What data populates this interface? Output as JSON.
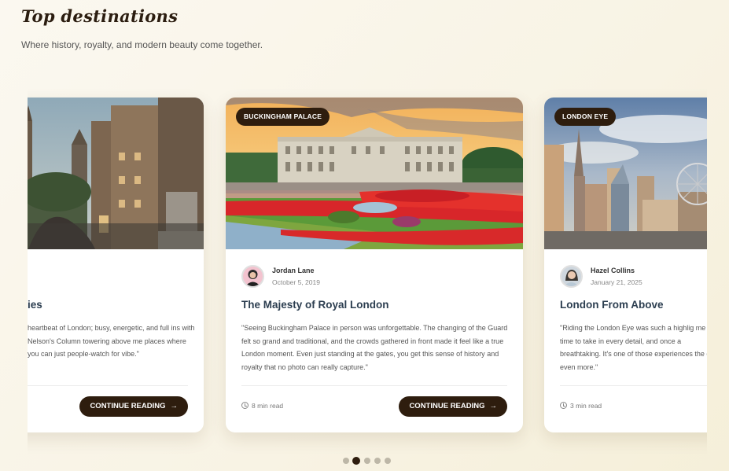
{
  "header": {
    "title": "Top destinations",
    "subtitle": "Where history, royalty, and modern beauty come together."
  },
  "cards": [
    {
      "tag": "",
      "author": "",
      "date": "",
      "title": "ies",
      "text": "heartbeat of London; busy, energetic, and full ins with Nelson's Column towering above me places where you can just people-watch for vibe.\"",
      "read_time": "",
      "button": "CONTINUE READING"
    },
    {
      "tag": "BUCKINGHAM PALACE",
      "author": "Jordan Lane",
      "date": "October 5, 2019",
      "title": "The Majesty of Royal London",
      "text": "\"Seeing Buckingham Palace in person was unforgettable. The changing of the Guard felt so grand and traditional, and the crowds gathered in front made it feel like a true London moment. Even just standing at the gates, you get this sense of history and royalty that no photo can really capture.\"",
      "read_time": "8 min read",
      "button": "CONTINUE READING"
    },
    {
      "tag": "LONDON EYE",
      "author": "Hazel Collins",
      "date": "January 21, 2025",
      "title": "London From Above",
      "text": "\"Riding the London Eye was such a highlig me time to take in every detail, and once a breathtaking. It's one of those experiences the city even more.\"",
      "read_time": "3 min read",
      "button": ""
    }
  ],
  "pagination": {
    "count": 5,
    "active": 1
  },
  "colors": {
    "accent": "#2e1d0e",
    "title": "#2c3e50",
    "dot": "#bdb7a7"
  }
}
